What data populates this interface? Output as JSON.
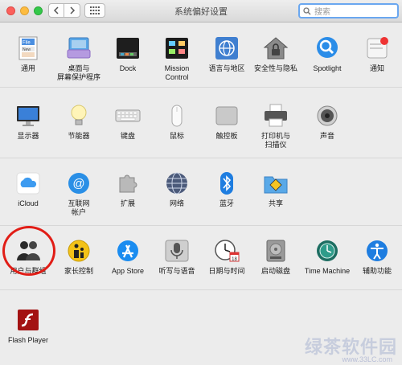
{
  "window": {
    "title": "系统偏好设置"
  },
  "search": {
    "placeholder": "搜索"
  },
  "sections": [
    {
      "items": [
        {
          "label": "通用",
          "icon": "general-icon"
        },
        {
          "label": "桌面与",
          "label2": "屏幕保护程序",
          "icon": "desktop-icon"
        },
        {
          "label": "Dock",
          "icon": "dock-icon"
        },
        {
          "label": "Mission",
          "label2": "Control",
          "icon": "mission-control-icon"
        },
        {
          "label": "语言与地区",
          "icon": "language-region-icon"
        },
        {
          "label": "安全性与隐私",
          "icon": "security-icon"
        },
        {
          "label": "Spotlight",
          "icon": "spotlight-icon"
        },
        {
          "label": "通知",
          "icon": "notifications-icon"
        }
      ]
    },
    {
      "items": [
        {
          "label": "显示器",
          "icon": "display-icon"
        },
        {
          "label": "节能器",
          "icon": "energy-saver-icon"
        },
        {
          "label": "键盘",
          "icon": "keyboard-icon"
        },
        {
          "label": "鼠标",
          "icon": "mouse-icon"
        },
        {
          "label": "触控板",
          "icon": "trackpad-icon"
        },
        {
          "label": "打印机与",
          "label2": "扫描仪",
          "icon": "printer-icon"
        },
        {
          "label": "声音",
          "icon": "sound-icon"
        }
      ]
    },
    {
      "items": [
        {
          "label": "iCloud",
          "icon": "icloud-icon"
        },
        {
          "label": "互联网",
          "label2": "帐户",
          "icon": "internet-accounts-icon"
        },
        {
          "label": "扩展",
          "icon": "extensions-icon"
        },
        {
          "label": "网络",
          "icon": "network-icon"
        },
        {
          "label": "蓝牙",
          "icon": "bluetooth-icon"
        },
        {
          "label": "共享",
          "icon": "sharing-icon"
        }
      ]
    },
    {
      "items": [
        {
          "label": "用户与群组",
          "icon": "users-groups-icon"
        },
        {
          "label": "家长控制",
          "icon": "parental-controls-icon"
        },
        {
          "label": "App Store",
          "icon": "app-store-icon"
        },
        {
          "label": "听写与语音",
          "icon": "dictation-icon"
        },
        {
          "label": "日期与时间",
          "icon": "date-time-icon"
        },
        {
          "label": "启动磁盘",
          "icon": "startup-disk-icon"
        },
        {
          "label": "Time Machine",
          "icon": "time-machine-icon"
        },
        {
          "label": "辅助功能",
          "icon": "accessibility-icon"
        }
      ]
    },
    {
      "items": [
        {
          "label": "Flash Player",
          "icon": "flash-player-icon"
        }
      ]
    }
  ],
  "watermark": {
    "text": "绿茶软件园",
    "url": "www.33LC.com"
  }
}
